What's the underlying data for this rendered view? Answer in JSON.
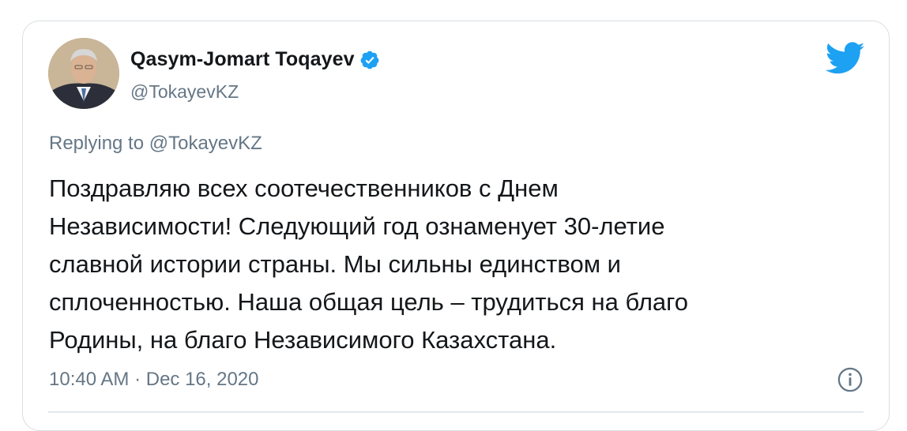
{
  "user": {
    "display_name": "Qasym-Jomart Toqayev",
    "handle": "@TokayevKZ",
    "verified": true,
    "avatar": "profile-photo"
  },
  "tweet": {
    "replying_to": "Replying to @TokayevKZ",
    "text": "Поздравляю всех соотечественников с Днем\nНезависимости! Следующий год ознаменует 30-летие\nславной истории страны. Мы сильны единством и\nсплоченностью. Наша общая цель – трудиться на благо\nРодины, на благо Независимого Казахстана.",
    "timestamp": "10:40 AM · Dec 16, 2020"
  },
  "icons": {
    "brand": "twitter-bird-icon",
    "verified": "verified-badge-icon",
    "info": "info-icon"
  },
  "colors": {
    "brand_blue": "#1da1f2",
    "text_primary": "#14171a",
    "text_secondary": "#657786"
  }
}
